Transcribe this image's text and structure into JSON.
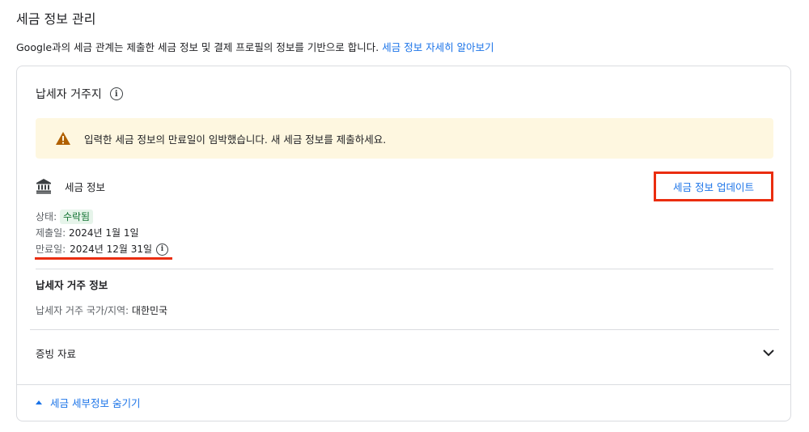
{
  "page": {
    "title": "세금 정보 관리",
    "intro_text": "Google과의 세금 관계는 제출한 세금 정보 및 결제 프로필의 정보를 기반으로 합니다.",
    "intro_link": "세금 정보 자세히 알아보기"
  },
  "section": {
    "title": "납세자 거주지",
    "info_icon": "info-icon"
  },
  "warning": {
    "icon": "warning-icon",
    "text": "입력한 세금 정보의 만료일이 임박했습니다. 새 세금 정보를 제출하세요."
  },
  "tax_info": {
    "icon": "bank-icon",
    "label": "세금 정보",
    "update_button": "세금 정보 업데이트",
    "status_label": "상태:",
    "status_value": "수락됨",
    "submitted_label": "제출일:",
    "submitted_value": "2024년 1월 1일",
    "expiry_label": "만료일:",
    "expiry_value": "2024년 12월 31일"
  },
  "residence": {
    "title": "납세자 거주 정보",
    "country_label": "납세자 거주 국가/지역:",
    "country_value": "대한민국"
  },
  "evidence": {
    "label": "증빙 자료",
    "icon": "chevron-down-icon"
  },
  "footer": {
    "hide_label": "세금 세부정보 숨기기"
  },
  "colors": {
    "accent": "#1a73e8",
    "highlight": "#ea2d0f",
    "warning_bg": "#fef7e0",
    "status_bg": "#e6f4ea"
  }
}
